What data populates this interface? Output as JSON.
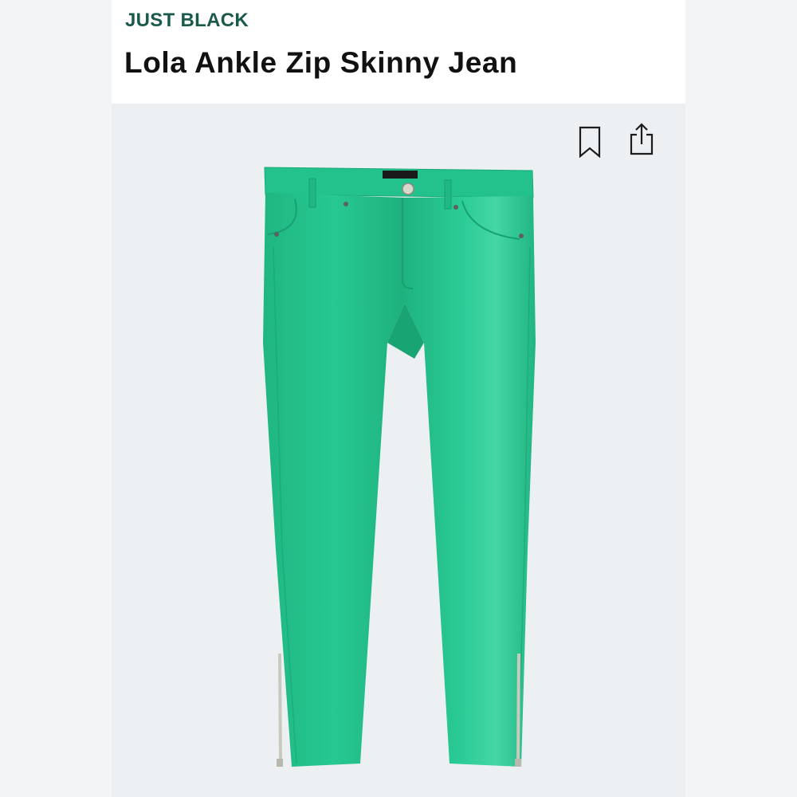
{
  "header": {
    "brand": "JUST BLACK",
    "product_name": "Lola Ankle Zip Skinny Jean"
  },
  "actions": {
    "bookmark_icon": "bookmark-icon",
    "share_icon": "share-icon"
  },
  "product_image": {
    "color": "#22c18a",
    "zipper_color": "#c9c9bd"
  },
  "colors": {
    "brand": "#1a5a4c",
    "title": "#111111",
    "background": "#edf0f3"
  }
}
